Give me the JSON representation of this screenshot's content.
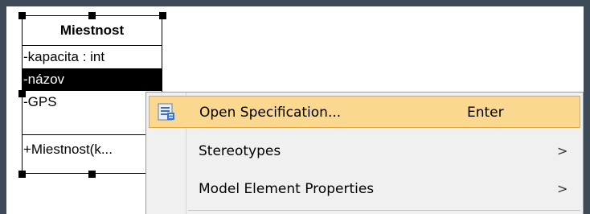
{
  "diagram": {
    "class": {
      "name": "Miestnost",
      "attributes": [
        "-kapacita : int",
        "-názov",
        "-GPS"
      ],
      "selected_attribute": 1,
      "operations": [
        "+Miestnost(k..."
      ]
    }
  },
  "context_menu": {
    "items": [
      {
        "label": "Open Specification...",
        "shortcut": "Enter",
        "icon": "specification-icon",
        "highlighted": true
      },
      {
        "label": "Stereotypes",
        "submenu_arrow": ">"
      },
      {
        "label": "Model Element Properties",
        "submenu_arrow": ">"
      }
    ]
  },
  "colors": {
    "frame": "#3d4a57",
    "menu_background": "#f0f0f0",
    "menu_highlight": "#fbd88f",
    "menu_highlight_border": "#e3a837"
  }
}
